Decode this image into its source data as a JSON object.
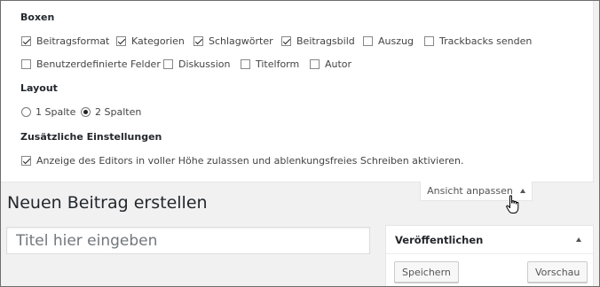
{
  "screen_options": {
    "boxes_title": "Boxen",
    "boxes": [
      {
        "label": "Beitragsformat",
        "checked": true
      },
      {
        "label": "Kategorien",
        "checked": true
      },
      {
        "label": "Schlagwörter",
        "checked": true
      },
      {
        "label": "Beitragsbild",
        "checked": true
      },
      {
        "label": "Auszug",
        "checked": false
      },
      {
        "label": "Trackbacks senden",
        "checked": false
      },
      {
        "label": "Benutzerdefinierte Felder",
        "checked": false
      },
      {
        "label": "Diskussion",
        "checked": false
      },
      {
        "label": "Titelform",
        "checked": false
      },
      {
        "label": "Autor",
        "checked": false
      }
    ],
    "layout_title": "Layout",
    "layout_options": [
      {
        "label": "1 Spalte",
        "selected": false
      },
      {
        "label": "2 Spalten",
        "selected": true
      }
    ],
    "additional_title": "Zusätzliche Einstellungen",
    "additional_option": {
      "label": "Anzeige des Editors in voller Höhe zulassen und ablenkungsfreies Schreiben aktivieren.",
      "checked": true
    }
  },
  "screen_options_tab": {
    "label": "Ansicht anpassen",
    "icon": "arrow-up-icon"
  },
  "page_title": "Neuen Beitrag erstellen",
  "title_input": {
    "placeholder": "Titel hier eingeben",
    "value": ""
  },
  "publish_box": {
    "title": "Veröffentlichen",
    "toggle_icon": "arrow-up-icon",
    "save_label": "Speichern",
    "preview_label": "Vorschau"
  },
  "cursor": {
    "icon": "hand-pointer-icon"
  }
}
